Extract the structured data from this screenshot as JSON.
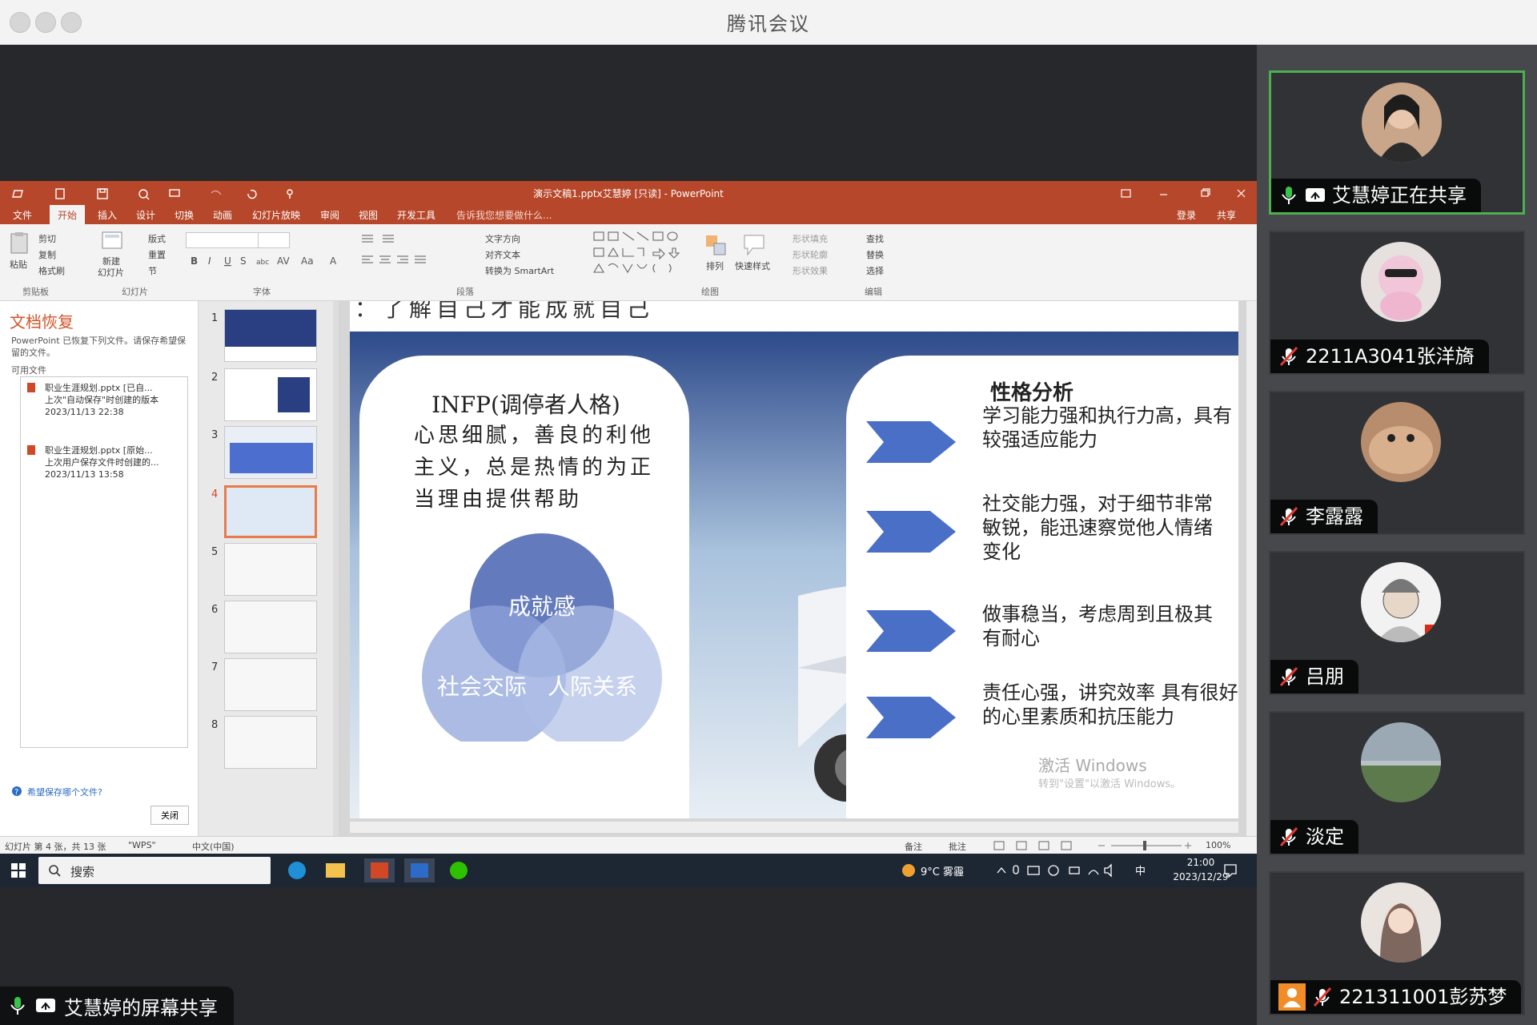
{
  "window": {
    "title": "腾讯会议"
  },
  "share_label": "艾慧婷的屏幕共享",
  "participants": [
    {
      "name": "艾慧婷正在共享",
      "sharing": true,
      "mic": "on"
    },
    {
      "name": "2211A3041张洋旖",
      "mic": "off"
    },
    {
      "name": "李露露",
      "mic": "off"
    },
    {
      "name": "吕朋",
      "mic": "off"
    },
    {
      "name": "淡定",
      "mic": "off"
    },
    {
      "name": "221311001彭苏梦",
      "mic": "off",
      "has_user_badge": true
    }
  ],
  "ppt": {
    "title": "演示文稿1.pptx艾慧婷 [只读] - PowerPoint",
    "tabs": [
      "文件",
      "开始",
      "插入",
      "设计",
      "切换",
      "动画",
      "幻灯片放映",
      "审阅",
      "视图",
      "开发工具"
    ],
    "tell_me": "告诉我您想要做什么...",
    "login": "登录",
    "share": "共享",
    "ribbon": {
      "paste": "粘贴",
      "cut": "剪切",
      "copy": "复制",
      "format_painter": "格式刷",
      "clipboard": "剪贴板",
      "new_slide_1": "新建",
      "new_slide_2": "幻灯片",
      "layout": "版式",
      "reset": "重置",
      "section": "节",
      "slides": "幻灯片",
      "font": "字体",
      "text_direction": "文字方向",
      "align_text": "对齐文本",
      "smartart": "转换为 SmartArt",
      "paragraph": "段落",
      "arrange": "排列",
      "quick_styles": "快速样式",
      "shape_fill": "形状填充",
      "shape_outline": "形状轮廓",
      "shape_effects": "形状效果",
      "drawing": "绘图",
      "find": "查找",
      "replace": "替换",
      "select": "选择",
      "editing": "编辑"
    },
    "recovery": {
      "title": "文档恢复",
      "desc": "PowerPoint 已恢复下列文件。请保存希望保留的文件。",
      "available": "可用文件",
      "files": [
        {
          "name": "职业生涯规划.pptx [已自...",
          "note": "上次\"自动保存\"时创建的版本",
          "time": "2023/11/13 22:38"
        },
        {
          "name": "职业生涯规划.pptx [原始...",
          "note": "上次用户保存文件时创建的...",
          "time": "2023/11/13 13:58"
        }
      ],
      "which": "希望保存哪个文件?",
      "close": "关闭"
    },
    "thumbs": [
      "1",
      "2",
      "3",
      "4",
      "5",
      "6",
      "7",
      "8"
    ],
    "slide": {
      "top_cut": "：了解自己才能成就自己",
      "infp_title": "INFP(调停者人格)",
      "infp_desc": "心思细腻，善良的利他主义，总是热情的为正当理由提供帮助",
      "circle_top": "成就感",
      "circle_left": "社会交际",
      "circle_right": "人际关系",
      "analysis_title": "性格分析",
      "points": [
        "学习能力强和执行力高，具有较强适应能力",
        "社交能力强，对于细节非常敏锐，能迅速察觉他人情绪变化",
        "做事稳当，考虑周到且极其有耐心",
        "责任心强，讲究效率 具有很好的心里素质和抗压能力"
      ],
      "watermark_1": "激活 Windows",
      "watermark_2": "转到\"设置\"以激活 Windows。"
    },
    "status": {
      "slide_info": "幻灯片 第 4 张，共 13 张",
      "theme": "\"WPS\"",
      "lang": "中文(中国)",
      "notes": "备注",
      "comments": "批注",
      "zoom": "100%"
    }
  },
  "taskbar": {
    "search": "搜索",
    "weather": "9°C 雾霾",
    "ime": "中",
    "time": "21:00",
    "date": "2023/12/29"
  },
  "colors": {
    "ppt_accent": "#b7472a",
    "active_border": "#4caf50",
    "chevron": "#4a6fc7",
    "circle_dark": "#5b73b8",
    "circle_light": "#8fa4db"
  }
}
